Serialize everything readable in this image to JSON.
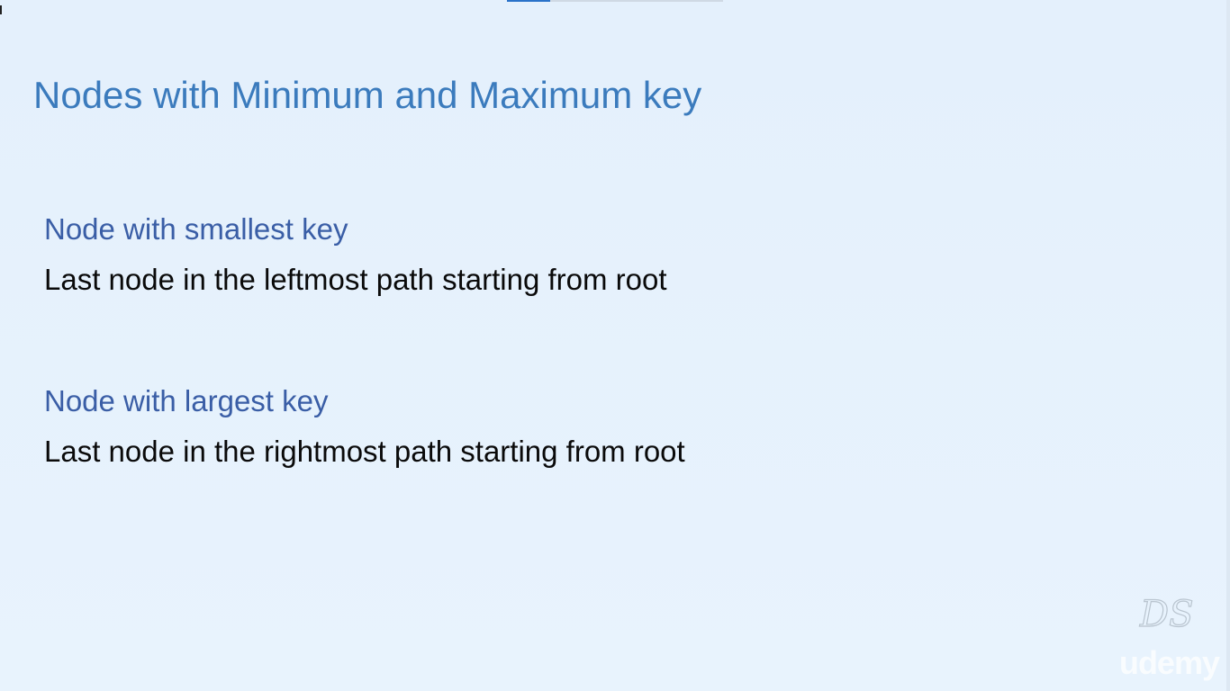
{
  "slide": {
    "title": "Nodes with Minimum and Maximum key",
    "sections": [
      {
        "heading": "Node with smallest key",
        "body": "Last node in the leftmost path starting from root"
      },
      {
        "heading": "Node with largest key",
        "body": "Last node in the rightmost path starting from root"
      }
    ]
  },
  "watermark": {
    "logo_text": "DS",
    "brand": "udemy"
  },
  "colors": {
    "background": "#e6f2fd",
    "title": "#3b7bbd",
    "heading": "#3a5ea6",
    "body": "#0a0a0a"
  }
}
